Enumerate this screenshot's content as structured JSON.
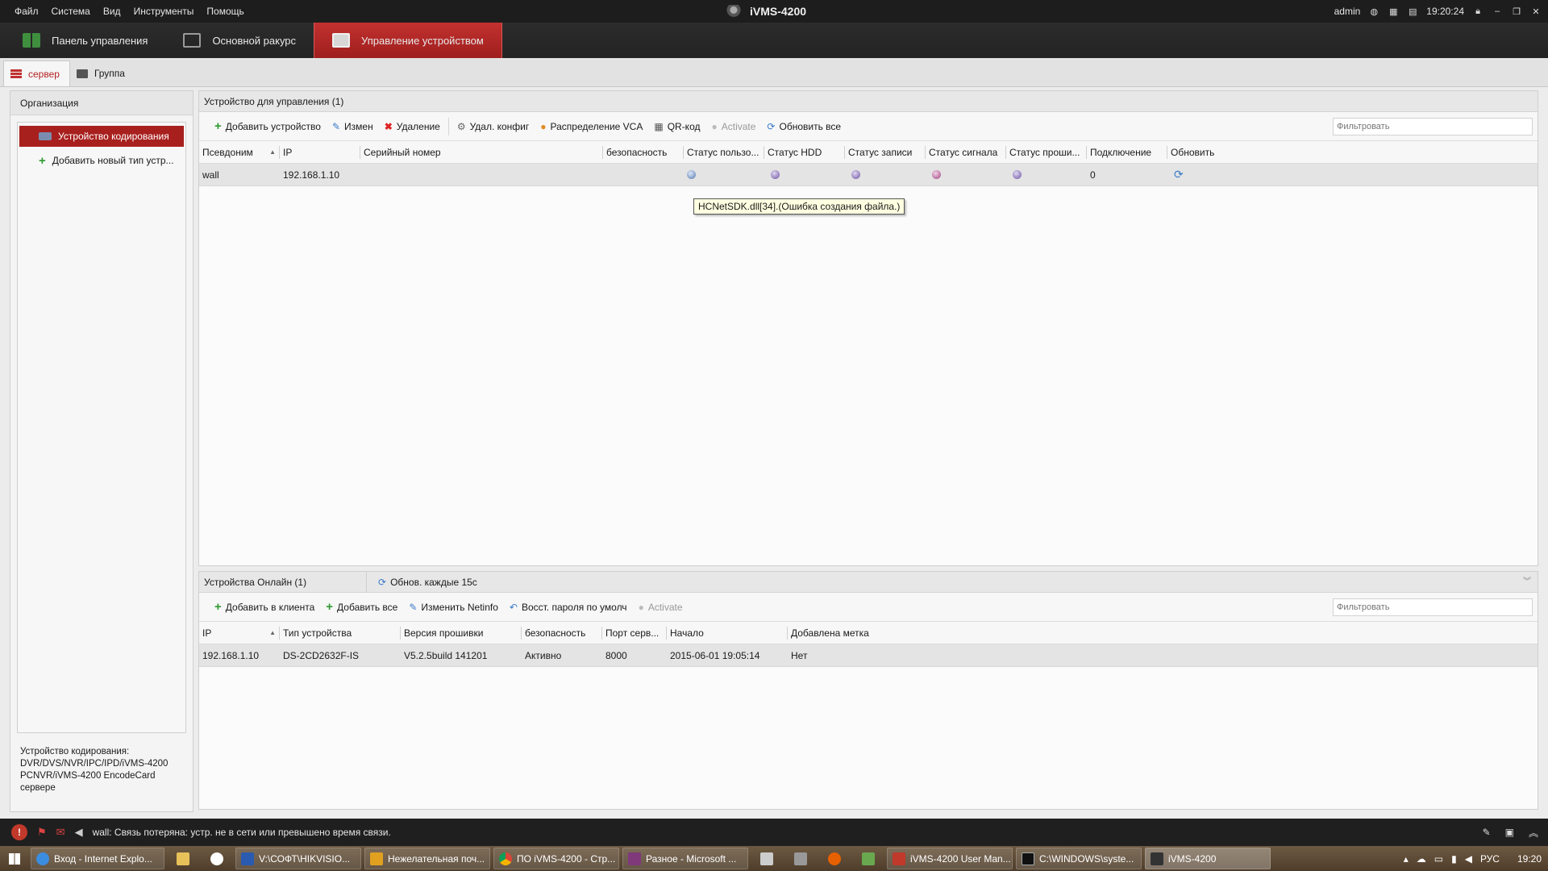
{
  "menu": [
    "Файл",
    "Система",
    "Вид",
    "Инструменты",
    "Помощь"
  ],
  "app_title": "iVMS-4200",
  "user": "admin",
  "clock": "19:20:24",
  "main_tabs": [
    {
      "label": "Панель управления"
    },
    {
      "label": "Основной ракурс"
    },
    {
      "label": "Управление устройством",
      "active": true
    }
  ],
  "sub_tabs": [
    {
      "label": "сервер",
      "active": true
    },
    {
      "label": "Группа"
    }
  ],
  "left_panel": {
    "header": "Организация",
    "tree": [
      "Устройство кодирования",
      "Добавить новый тип устр..."
    ],
    "info": [
      "Устройство кодирования:",
      "DVR/DVS/NVR/IPC/IPD/iVMS-4200",
      "PCNVR/iVMS-4200 EncodeCard",
      "сервере"
    ]
  },
  "managed": {
    "header": "Устройство для управления (1)",
    "toolbar": [
      "Добавить устройство",
      "Измен",
      "Удаление",
      "Удал. конфиг",
      "Распределение VCA",
      "QR-код",
      "Activate",
      "Обновить все"
    ],
    "filter_placeholder": "Фильтровать",
    "columns": [
      "Псевдоним",
      "IP",
      "Серийный номер",
      "безопасность",
      "Статус пользо...",
      "Статус HDD",
      "Статус записи",
      "Статус сигнала",
      "Статус проши...",
      "Подключение",
      "Обновить"
    ],
    "rows": [
      {
        "alias": "wall",
        "ip": "192.168.1.10",
        "serial": "",
        "security": "",
        "connection": "0"
      }
    ],
    "tooltip": "HCNetSDK.dll[34].(Ошибка создания файла.)"
  },
  "online": {
    "header": "Устройства Онлайн (1)",
    "refresh": "Обнов. каждые 15с",
    "toolbar": [
      "Добавить в клиента",
      "Добавить все",
      "Изменить Netinfo",
      "Восст. пароля по умолч",
      "Activate"
    ],
    "filter_placeholder": "Фильтровать",
    "columns": [
      "IP",
      "Тип устройства",
      "Версия прошивки",
      "безопасность",
      "Порт серв...",
      "Начало",
      "Добавлена метка"
    ],
    "rows": [
      [
        "192.168.1.10",
        "DS-2CD2632F-IS",
        "V5.2.5build 141201",
        "Активно",
        "8000",
        "2015-06-01 19:05:14",
        "Нет"
      ]
    ]
  },
  "status_message": "wall: Связь потеряна: устр. не в сети или превышено время связи.",
  "taskbar": {
    "items": [
      "Вход - Internet Explo...",
      "V:\\СОФТ\\HIKVISIO...",
      "Нежелательная поч...",
      "ПО iVMS-4200 - Стр...",
      "Разное - Microsoft ...",
      "iVMS-4200 User Man...",
      "C:\\WINDOWS\\syste...",
      "iVMS-4200"
    ],
    "lang": "РУС",
    "time": "19:20"
  },
  "colors": {
    "accent": "#a8201e",
    "titlebar": "#1d1d1d",
    "row_bg": "#e4e4e4"
  }
}
